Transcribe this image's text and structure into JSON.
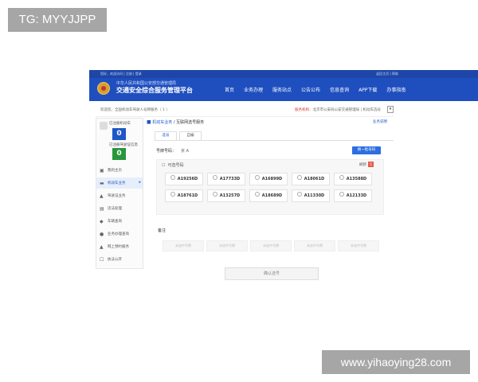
{
  "watermarks": {
    "top": "TG: MYYJJPP",
    "bottom": "www.yihaoying28.com"
  },
  "topbar": {
    "left_text": "您好，欢迎访问 | 注册 | 登录",
    "right_text": "返回主页 | 帮助"
  },
  "header": {
    "subtitle": "中华人民共和国公安部交通管理局",
    "title": "交通安全综合服务管理平台",
    "nav": [
      "首页",
      "业务办理",
      "服务站点",
      "公告公布",
      "信息查询",
      "APP下载",
      "办事指南"
    ]
  },
  "info": {
    "left": "欢迎您，全国机动车驾驶人号牌服务（ 1 ）",
    "right_label": "服务机构：",
    "right_value": "北京市公安局公安交通管理局 | 机动车选号"
  },
  "sidebar": {
    "stats": [
      {
        "label": "已注册机动车",
        "value": "0",
        "color": "#1e57c8"
      },
      {
        "label": "已注册驾驶证信息",
        "value": "0",
        "color": "#27973a"
      }
    ],
    "menu": [
      {
        "icon": "▣",
        "label": "我的主页",
        "icon_name": "home-icon"
      },
      {
        "icon": "▬",
        "label": "机动车业务",
        "icon_name": "car-icon",
        "active": true
      },
      {
        "icon": "▲",
        "label": "驾驶证业务",
        "icon_name": "license-icon"
      },
      {
        "icon": "▤",
        "label": "违法处理",
        "icon_name": "violation-icon"
      },
      {
        "icon": "◆",
        "label": "车辆查询",
        "icon_name": "query-icon"
      },
      {
        "icon": "●",
        "label": "业务办理查询",
        "icon_name": "people-icon"
      },
      {
        "icon": "▲",
        "label": "网上预约服务",
        "icon_name": "user-icon"
      },
      {
        "icon": "☐",
        "label": "执法公开",
        "icon_name": "doc-icon"
      }
    ]
  },
  "main": {
    "breadcrumb": [
      "机动车业务",
      "互联网选号服务"
    ],
    "help_link": "业务说明",
    "tabs": [
      "选号",
      "自编"
    ],
    "plate_label": "号牌号码：",
    "plate_prefix": "京 A",
    "change_button": "换一批号码",
    "select_title": "可选号码",
    "refresh_label": "刷新",
    "refresh_count": "5",
    "plates": [
      "A19256D",
      "A17733D",
      "A16899D",
      "A18061D",
      "A13588D",
      "A18761D",
      "A13257D",
      "A18689D",
      "A11330D",
      "A12133D"
    ],
    "remark_label": "备注",
    "options": [
      "未选中号牌",
      "未选中号牌",
      "未选中号牌",
      "未选中号牌",
      "未选中号牌"
    ],
    "confirm_button": "确认选号"
  }
}
